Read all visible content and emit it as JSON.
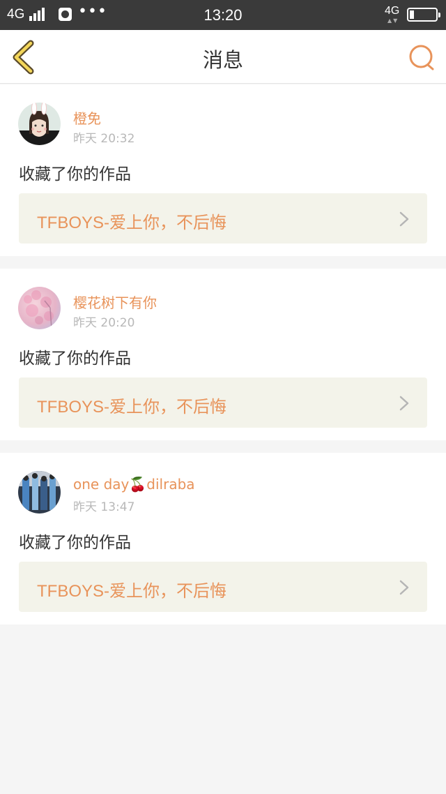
{
  "status_bar": {
    "network_left": "4G",
    "time": "13:20",
    "network_right": "4G",
    "more_dots": "•••"
  },
  "header": {
    "title": "消息",
    "back_icon": "chevron-left-icon",
    "search_icon": "search-icon",
    "accent_color": "#e8935a"
  },
  "notifications": [
    {
      "username": "橙免",
      "time": "昨天 20:32",
      "action": "收藏了你的作品",
      "work_title": "TFBOYS-爱上你，不后悔"
    },
    {
      "username": "樱花树下有你",
      "time": "昨天 20:20",
      "action": "收藏了你的作品",
      "work_title": "TFBOYS-爱上你，不后悔"
    },
    {
      "username_prefix": "one day",
      "username_emoji": "🍒",
      "username_suffix": "dilraba",
      "time": "昨天 13:47",
      "action": "收藏了你的作品",
      "work_title": "TFBOYS-爱上你，不后悔"
    }
  ]
}
